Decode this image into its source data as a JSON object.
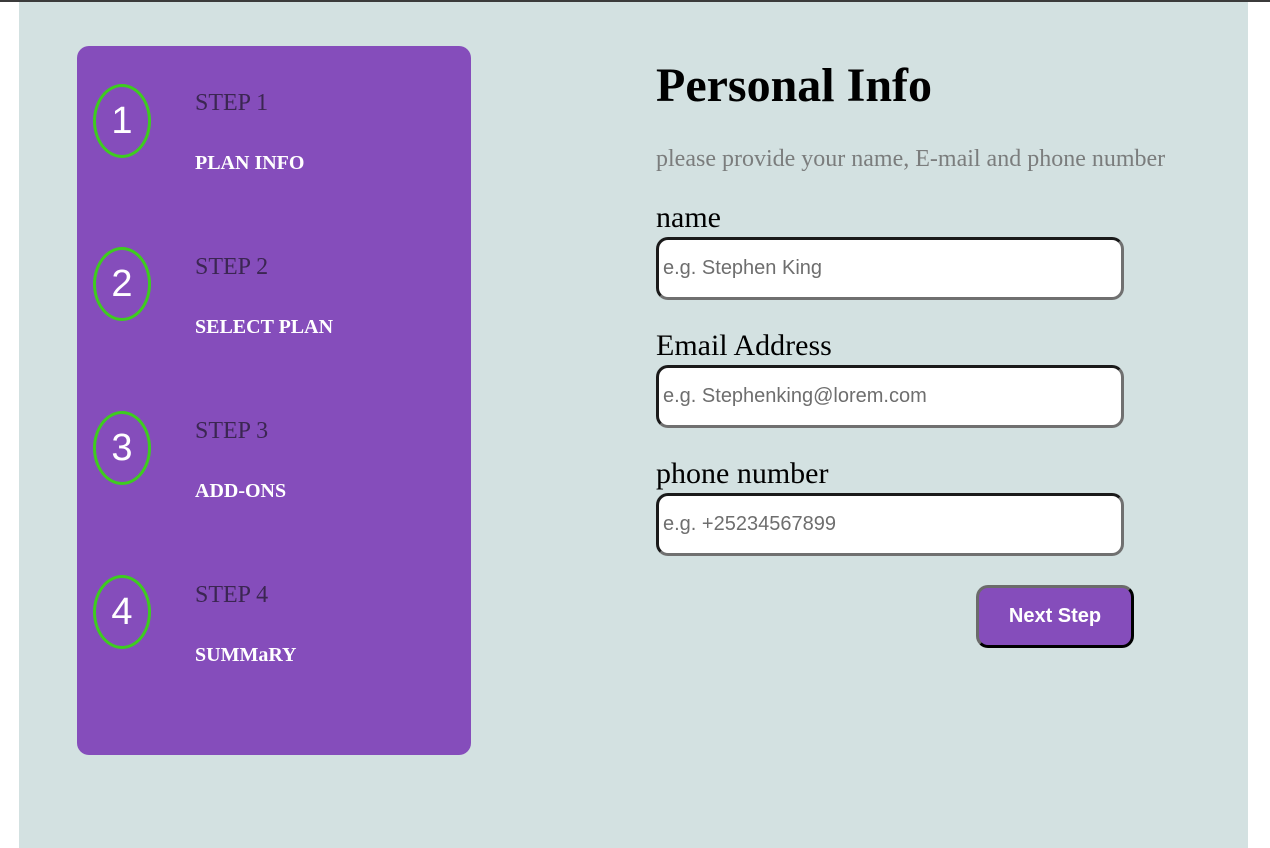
{
  "sidebar": {
    "steps": [
      {
        "number": "1",
        "label": "STEP 1",
        "title": "PLAN INFO"
      },
      {
        "number": "2",
        "label": "STEP 2",
        "title": "SELECT PLAN"
      },
      {
        "number": "3",
        "label": "STEP 3",
        "title": "ADD-ONS"
      },
      {
        "number": "4",
        "label": "STEP 4",
        "title": "SUMMaRY"
      }
    ]
  },
  "main": {
    "title": "Personal Info",
    "subtitle": "please provide your name, E-mail and phone number",
    "fields": {
      "name": {
        "label": "name",
        "value": "",
        "placeholder": "e.g. Stephen King"
      },
      "email": {
        "label": "Email Address",
        "value": "",
        "placeholder": "e.g. Stephenking@lorem.com"
      },
      "phone": {
        "label": "phone number",
        "value": "",
        "placeholder": "e.g. +25234567899"
      }
    },
    "next_button": "Next Step"
  },
  "colors": {
    "page_background": "#d3e1e1",
    "sidebar_background": "#854dbb",
    "step_circle_border": "#3ecc1f",
    "button_background": "#854dbb",
    "subtitle_text": "#7b7d7d"
  },
  "icons": []
}
